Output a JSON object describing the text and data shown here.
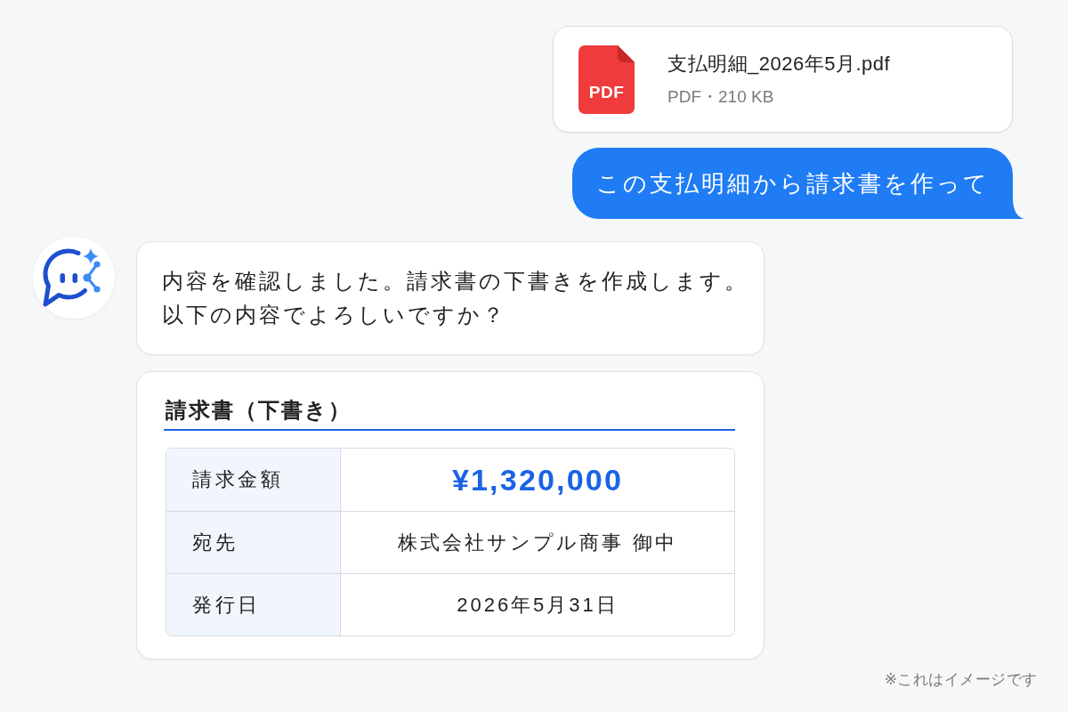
{
  "attachment": {
    "icon_label": "PDF",
    "file_name": "支払明細_2026年5月.pdf",
    "meta": "PDF・210 KB"
  },
  "user_message": {
    "text": "この支払明細から請求書を作って"
  },
  "assistant": {
    "message": "内容を確認しました。請求書の下書きを作成します。以下の内容でよろしいですか？",
    "invoice_card": {
      "title": "請求書（下書き）",
      "rows": [
        {
          "label": "請求金額",
          "value": "¥1,320,000",
          "kind": "amount"
        },
        {
          "label": "宛先",
          "value": "株式会社サンプル商事 御中",
          "kind": "text"
        },
        {
          "label": "発行日",
          "value": "2026年5月31日",
          "kind": "text"
        }
      ]
    }
  },
  "footnote": "※これはイメージです"
}
